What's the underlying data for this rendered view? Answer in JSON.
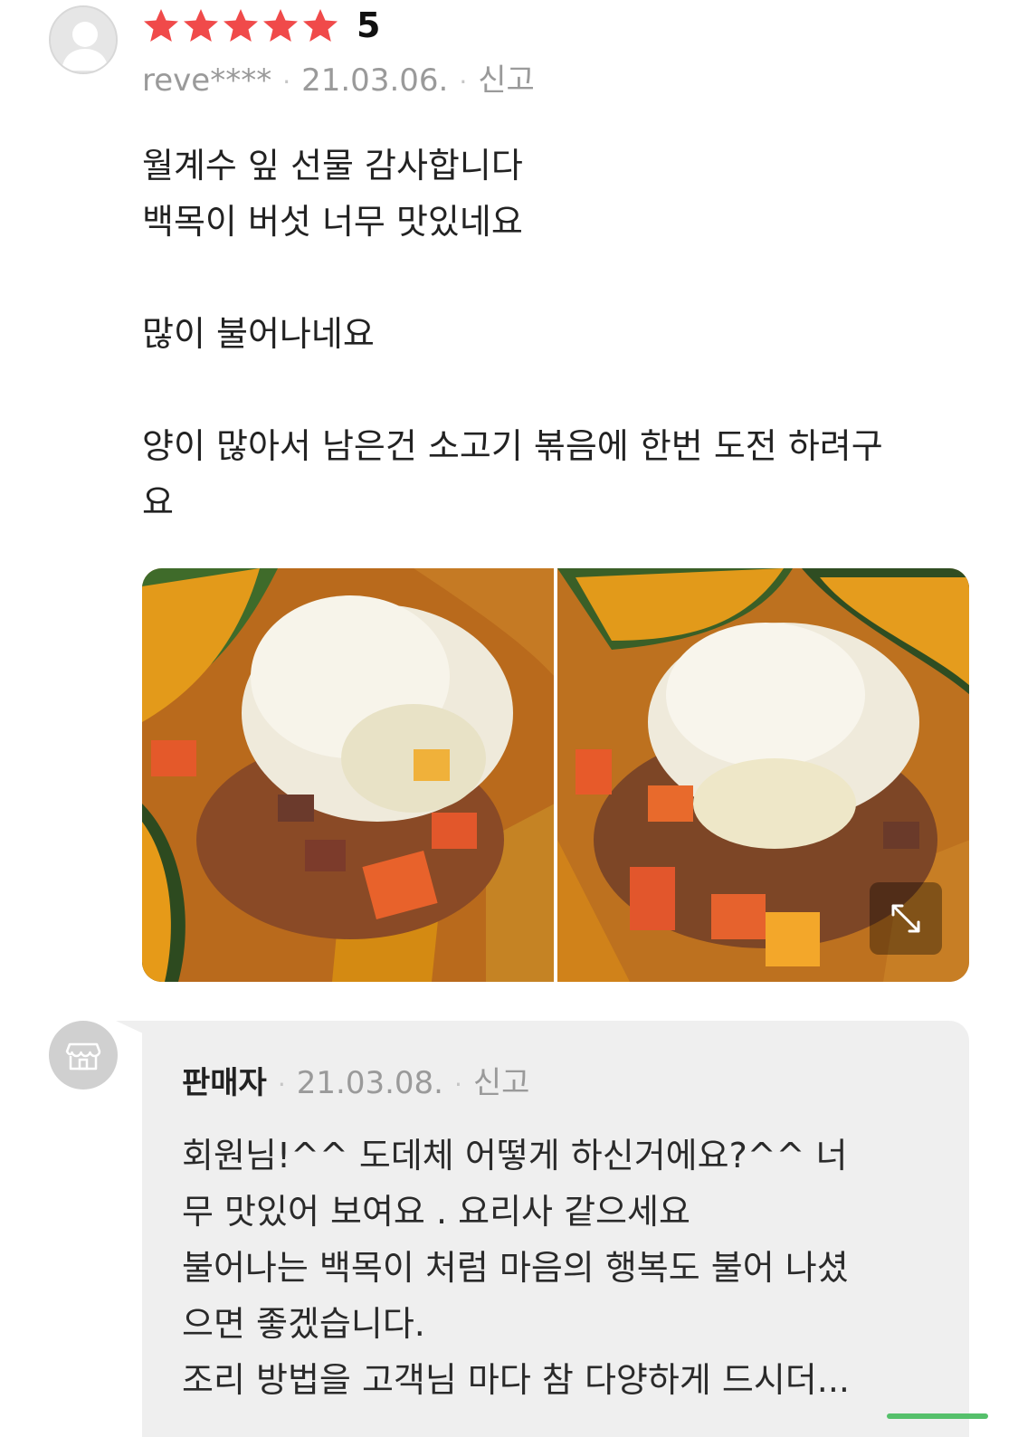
{
  "review": {
    "rating": 5,
    "rating_text": "5",
    "stars_count": 5,
    "star_color": "#f04a4a",
    "user_id": "reve****",
    "date": "21.03.06.",
    "report_label": "신고",
    "separator": "·",
    "lines": [
      "월계수 잎 선물 감사합니다",
      "백목이 버섯 너무 맛있네요",
      "",
      "많이 불어나네요",
      "",
      "양이 많아서 남은건 소고기 볶음에 한번 도전 하려구",
      "요"
    ],
    "photos": [
      {
        "alt_icon": "food-photo"
      },
      {
        "alt_icon": "food-photo"
      }
    ],
    "expand_icon": "expand-icon"
  },
  "reply": {
    "author": "판매자",
    "date": "21.03.08.",
    "report_label": "신고",
    "separator": "·",
    "avatar_icon": "store-icon",
    "lines": [
      "회원님!^^ 도데체 어떻게 하신거에요?^^  너",
      "무 맛있어 보여요 . 요리사 같으세요",
      "불어나는 백목이 처럼 마음의 행복도 불어 나셨",
      "으면 좋겠습니다.",
      "조리 방법을 고객님 마다 참 다양하게 드시더..."
    ],
    "bg_color": "#efefef"
  }
}
